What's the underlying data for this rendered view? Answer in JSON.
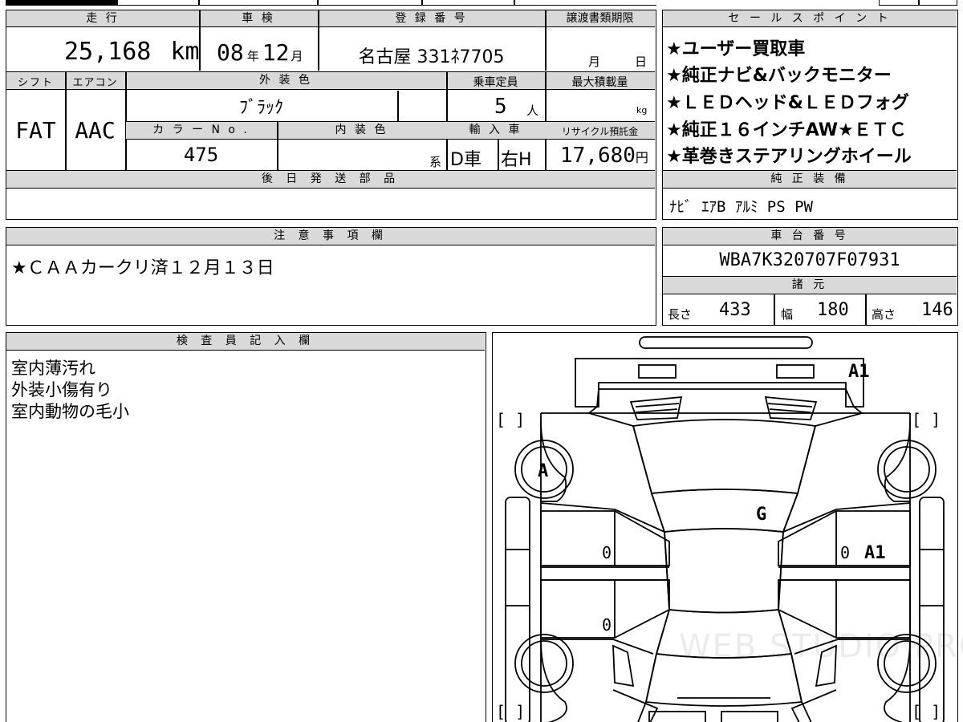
{
  "vehicle": {
    "mileage_label": "走 行",
    "mileage_value": "25,168",
    "mileage_unit": "km",
    "inspection_label": "車 検",
    "inspection_year": "08",
    "inspection_year_unit": "年",
    "inspection_month": "12",
    "inspection_month_unit": "月",
    "registration_label": "登 録 番 号",
    "registration_value": "名古屋 331ﾈ7705",
    "transfer_label": "譲渡書類期限",
    "transfer_month_unit": "月",
    "transfer_day_unit": "日",
    "shift_label": "シフト",
    "shift_value": "FAT",
    "ac_label": "エアコン",
    "ac_value": "AAC",
    "exterior_label": "外 装 色",
    "exterior_value": "ﾌﾞﾗｯｸ",
    "capacity_label": "乗車定員",
    "capacity_value": "5",
    "capacity_unit": "人",
    "maxload_label": "最大積載量",
    "maxload_unit": "kg",
    "colorno_label": "カ ラ ー N o .",
    "colorno_value": "475",
    "interior_label": "内 装 色",
    "interior_unit": "系",
    "import_label": "輸 入 車",
    "import_value_1": "D車",
    "import_value_2": "右H",
    "recycle_label": "リサイクル預託金",
    "recycle_value": "17,680",
    "recycle_unit": "円",
    "later_parts_label": "後 日 発 送 部 品",
    "later_parts_value": ""
  },
  "sales_points": {
    "label": "セ ー ル ス ポ イ ン ト",
    "items": [
      "★ユーザー買取車",
      "★純正ナビ&バックモニター",
      "★ＬＥＤヘッド&ＬＥＤフォグ",
      "★純正１６インチAW★ＥＴＣ",
      "★革巻きステアリングホイール"
    ]
  },
  "equipment": {
    "label": "純 正 装 備",
    "value": "ﾅﾋﾞ ｴｱB ｱﾙﾐ PS PW"
  },
  "notes": {
    "label": "注 意 事 項 欄",
    "value": "★ＣＡＡカークリ済１２月１３日"
  },
  "chassis": {
    "label": "車 台 番 号",
    "value": "WBA7K320707F07931"
  },
  "specs": {
    "label": "諸 元",
    "length_label": "長さ",
    "length_value": "433",
    "width_label": "幅",
    "width_value": "180",
    "height_label": "高さ",
    "height_value": "146"
  },
  "inspector": {
    "label": "検 査 員 記 入 欄",
    "lines": [
      "室内薄汚れ",
      "外装小傷有り",
      "室内動物の毛小"
    ]
  },
  "diagram": {
    "marks": {
      "front_a1": "A1",
      "wheel_a": "A",
      "windshield_g": "G",
      "right_door_a1": "A1",
      "zero_left_front": "0",
      "zero_right_front": "0",
      "zero_left_rear": "0"
    },
    "brackets": "[    ]",
    "watermark": "WEB STUDIO PRO"
  }
}
